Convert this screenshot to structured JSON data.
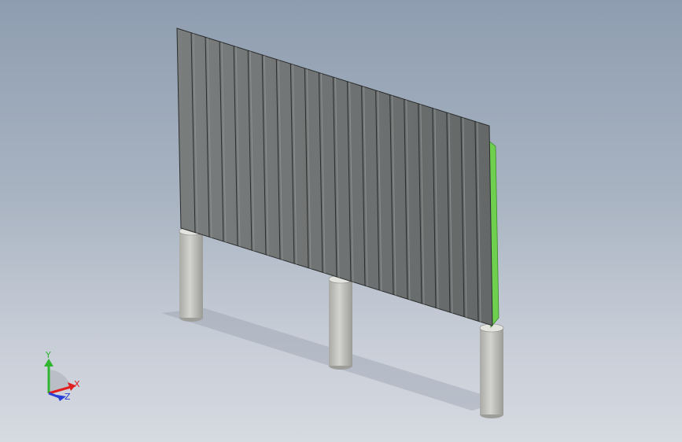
{
  "viewport": {
    "background_top": "#8e9db0",
    "background_bottom": "#d6dae1"
  },
  "model": {
    "panel_color": "#6f7272",
    "slat_line_color": "#2a2c2c",
    "edge_color": "#6fcf4f",
    "post_color": "#c8c9c4",
    "slat_count": 22,
    "post_count": 3
  },
  "triad": {
    "x_label": "X",
    "y_label": "Y",
    "z_label": "Z",
    "x_color": "#e02020",
    "y_color": "#2fb52f",
    "z_color": "#2a3fd8"
  }
}
